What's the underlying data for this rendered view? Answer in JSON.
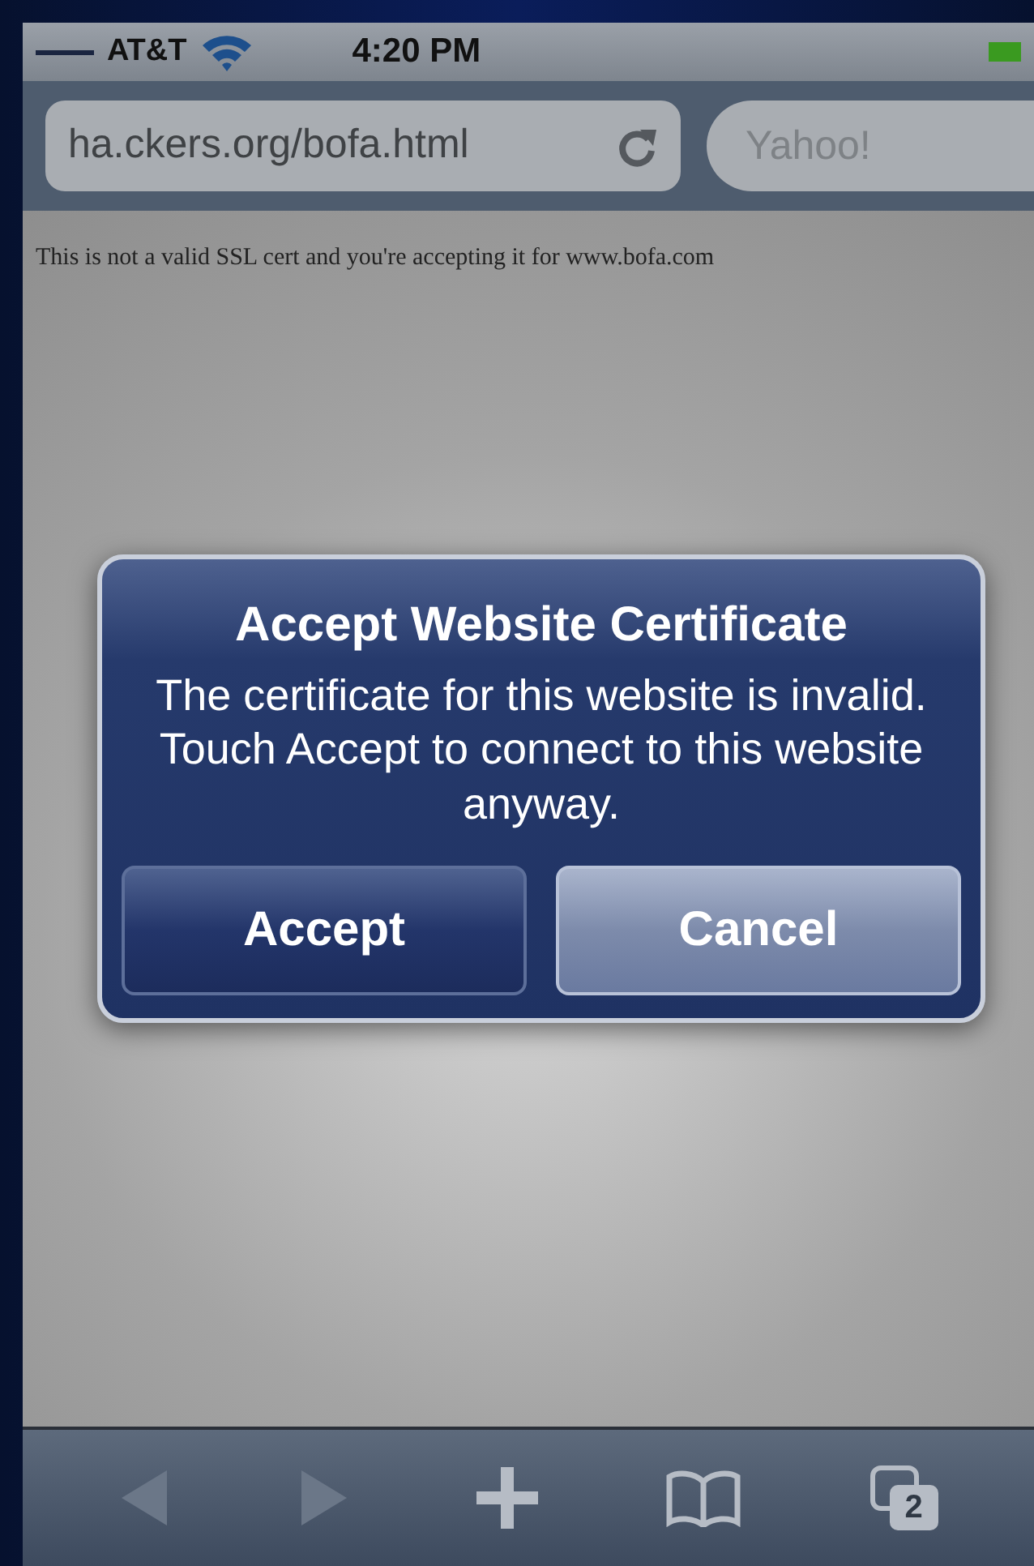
{
  "status_bar": {
    "carrier": "AT&T",
    "time": "4:20 PM"
  },
  "address_bar": {
    "url": "ha.ckers.org/bofa.html",
    "search_placeholder": "Yahoo!"
  },
  "page": {
    "text": "This is not a valid SSL cert and you're accepting it for www.bofa.com"
  },
  "alert": {
    "title": "Accept Website Certificate",
    "message": "The certificate for this website is invalid. Touch Accept to connect to this website anyway.",
    "buttons": [
      {
        "label": "Accept",
        "kind": "plain"
      },
      {
        "label": "Cancel",
        "kind": "highlighted"
      }
    ]
  },
  "toolbar": {
    "back_disabled": true,
    "forward_disabled": true,
    "tab_count": "2"
  }
}
